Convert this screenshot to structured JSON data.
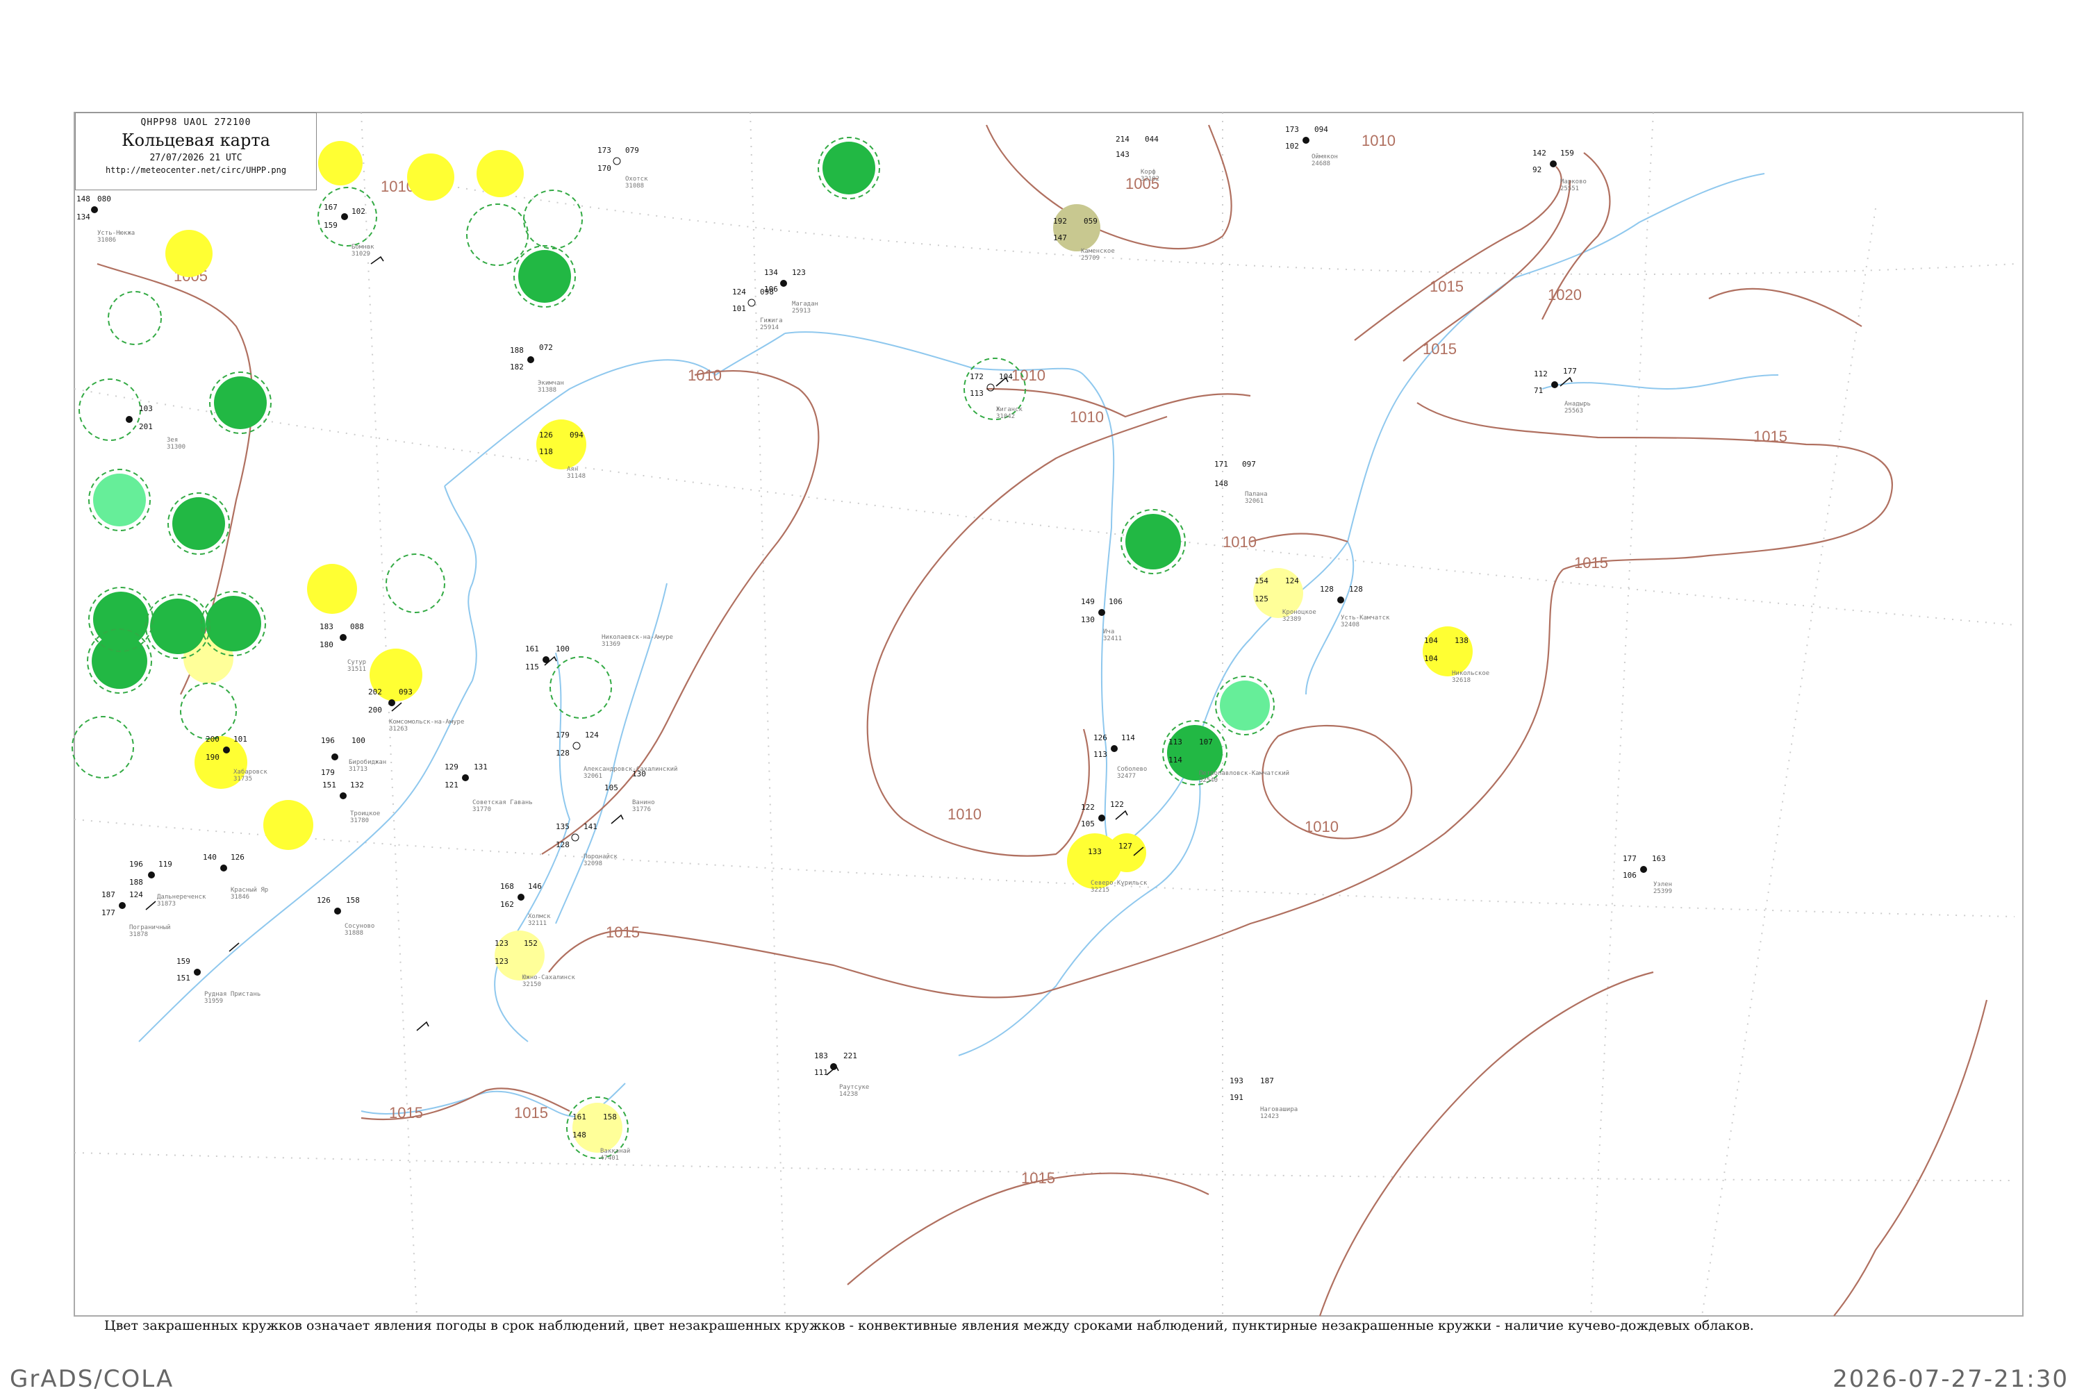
{
  "legend": {
    "code": "QHPP98  UAOL  272100",
    "title": "Кольцевая карта",
    "date": "27/07/2026 21 UTC",
    "url": "http://meteocenter.net/circ/UHPP.png"
  },
  "caption": "Цвет закрашенных кружков означает явления погоды в срок наблюдений, цвет незакрашенных кружков - конвективные явления между сроками наблюдений, пунктирные незакрашенные кружки - наличие кучево-дождевых облаков.",
  "footer": {
    "left": "GrADS/COLA",
    "right": "2026-07-27-21:30"
  },
  "colors": {
    "coast": "#8fc8ee",
    "isobar": "#b07060",
    "frame": "#aaaaaa",
    "yellow": "#ffff33",
    "pale_yellow": "#ffff99",
    "green": "#22b844",
    "light_green": "#66ee99",
    "olive": "#c8c890",
    "dash": "#33aa44"
  },
  "isobar_labels": [
    "1005",
    "1010",
    "1005",
    "1010",
    "1010",
    "1010",
    "1010",
    "1010",
    "1015",
    "1015",
    "1020",
    "1015",
    "1015",
    "1015",
    "1015",
    "1010",
    "1010",
    "1015",
    "1015"
  ],
  "stations": [
    {
      "name": "Усть-Нюкжа",
      "id": "31086",
      "t": "148",
      "dp": "134",
      "p": "080"
    },
    {
      "name": "Зея",
      "id": "31300",
      "t": "203",
      "dp": "201",
      "p": "103"
    },
    {
      "name": "Бомнак",
      "id": "31029",
      "t": "167",
      "dp": "159",
      "p": "102"
    },
    {
      "name": "Экимчан",
      "id": "31388",
      "t": "188",
      "dp": "182",
      "p": "072"
    },
    {
      "name": "Аян",
      "id": "31148",
      "t": "126",
      "dp": "118",
      "p": "094"
    },
    {
      "name": "Сутур",
      "id": "31511",
      "t": "183",
      "dp": "180",
      "p": "088"
    },
    {
      "name": "Комсомольск-на-Амуре",
      "id": "31263",
      "t": "202",
      "dp": "200",
      "p": "093"
    },
    {
      "name": "Николаевск-на-Амуре",
      "id": "31369",
      "t": "161",
      "dp": "115",
      "p": "100"
    },
    {
      "name": "Биробиджан",
      "id": "31713",
      "t": "196",
      "dp": "179",
      "p": "100"
    },
    {
      "name": "Хабаровск",
      "id": "31735",
      "t": "200",
      "dp": "190",
      "p": "101"
    },
    {
      "name": "Троицкое",
      "id": "31780",
      "t": "151",
      "dp": "",
      "p": "132"
    },
    {
      "name": "Дальнереченск",
      "id": "31873",
      "t": "196",
      "dp": "188",
      "p": "119"
    },
    {
      "name": "Красный Яр",
      "id": "31846",
      "t": "140",
      "dp": "",
      "p": "126"
    },
    {
      "name": "Пограничный",
      "id": "31878",
      "t": "187",
      "dp": "177",
      "p": "124"
    },
    {
      "name": "Рудная Пристань",
      "id": "31959",
      "t": "159",
      "dp": "151",
      "p": ""
    },
    {
      "name": "Сосуново",
      "id": "31888",
      "t": "126",
      "dp": "",
      "p": "158"
    },
    {
      "name": "Советская Гавань",
      "id": "31770",
      "t": "129",
      "dp": "121",
      "p": "131"
    },
    {
      "name": "Александровск-Сахалинский",
      "id": "32061",
      "t": "179",
      "dp": "128",
      "p": "124"
    },
    {
      "name": "Поронайск",
      "id": "32098",
      "t": "135",
      "dp": "128",
      "p": "141"
    },
    {
      "name": "Южно-Сахалинск",
      "id": "32150",
      "t": "123",
      "dp": "123",
      "p": "152"
    },
    {
      "name": "Холмск",
      "id": "32111",
      "t": "168",
      "dp": "162",
      "p": "146"
    },
    {
      "name": "Вакканай",
      "id": "47401",
      "t": "161",
      "dp": "148",
      "p": "158"
    },
    {
      "name": "Охотск",
      "id": "31088",
      "t": "173",
      "dp": "170",
      "p": "079"
    },
    {
      "name": "Магадан",
      "id": "25913",
      "t": "134",
      "dp": "106",
      "p": "123"
    },
    {
      "name": "Северо-Курильск",
      "id": "32215",
      "t": "133",
      "dp": "",
      "p": "127"
    },
    {
      "name": "Петропавловск-Камчатский",
      "id": "32540",
      "t": "113",
      "dp": "114",
      "p": "107"
    },
    {
      "name": "Кроноцкое",
      "id": "32389",
      "t": "154",
      "dp": "125",
      "p": "124"
    },
    {
      "name": "Усть-Камчатск",
      "id": "32408",
      "t": "128",
      "dp": "",
      "p": "128"
    },
    {
      "name": "Никольское",
      "id": "32618",
      "t": "104",
      "dp": "104",
      "p": "138"
    },
    {
      "name": "Ича",
      "id": "32411",
      "t": "149",
      "dp": "130",
      "p": "106"
    },
    {
      "name": "Соболево",
      "id": "32477",
      "t": "126",
      "dp": "113",
      "p": "114"
    },
    {
      "name": "Озерная",
      "id": "32594",
      "t": "122",
      "dp": "105",
      "p": "122"
    },
    {
      "name": "Палана",
      "id": "32061",
      "t": "171",
      "dp": "148",
      "p": "097"
    },
    {
      "name": "Каменское",
      "id": "25709",
      "t": "192",
      "dp": "147",
      "p": "059"
    },
    {
      "name": "Корф",
      "id": "32102",
      "t": "214",
      "dp": "143",
      "p": "044"
    },
    {
      "name": "Марково",
      "id": "25551",
      "t": "142",
      "dp": "92",
      "p": "159"
    },
    {
      "name": "Анадырь",
      "id": "25563",
      "t": "112",
      "dp": "71",
      "p": "177"
    },
    {
      "name": "Оймякон",
      "id": "24688",
      "t": "173",
      "dp": "102",
      "p": "094"
    },
    {
      "name": "Уэлен",
      "id": "25399",
      "t": "177",
      "dp": "106",
      "p": "163"
    },
    {
      "name": "Раутсуке",
      "id": "14238",
      "t": "183",
      "dp": "111",
      "p": "221"
    },
    {
      "name": "Наговашира",
      "id": "12423",
      "t": "193",
      "dp": "191",
      "p": "187"
    },
    {
      "name": "Ванино",
      "id": "31776",
      "t": "105",
      "dp": "",
      "p": "130"
    },
    {
      "name": "Гижига",
      "id": "25914",
      "t": "124",
      "dp": "101",
      "p": "098"
    },
    {
      "name": "Жиганск",
      "id": "31042",
      "t": "172",
      "dp": "113",
      "p": "104"
    }
  ]
}
